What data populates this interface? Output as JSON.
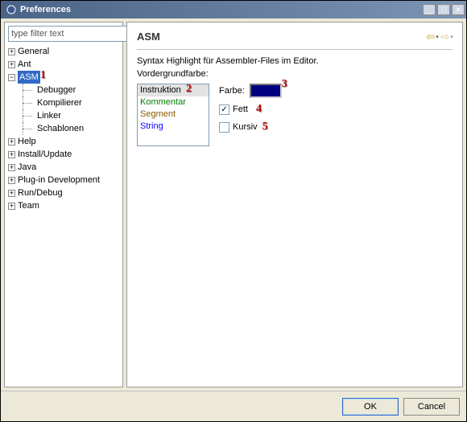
{
  "window": {
    "title": "Preferences"
  },
  "filter": {
    "placeholder": "type filter text"
  },
  "tree": {
    "general": "General",
    "ant": "Ant",
    "asm": "ASM",
    "asm_children": {
      "debugger": "Debugger",
      "kompilierer": "Kompilierer",
      "linker": "Linker",
      "schablonen": "Schablonen"
    },
    "help": "Help",
    "install": "Install/Update",
    "java": "Java",
    "plugin": "Plug-in Development",
    "run": "Run/Debug",
    "team": "Team"
  },
  "page": {
    "title": "ASM",
    "desc": "Syntax Highlight für Assembler-Files im Editor.",
    "fg_label": "Vordergrundfarbe:",
    "items": {
      "instruktion": "Instruktion",
      "kommentar": "Kommentar",
      "segment": "Segment",
      "string": "String"
    },
    "farbe_label": "Farbe:",
    "fett_label": "Fett",
    "kursiv_label": "Kursiv",
    "color_value": "#000080"
  },
  "buttons": {
    "ok": "OK",
    "cancel": "Cancel"
  },
  "hints": {
    "h1": "1",
    "h2": "2",
    "h3": "3",
    "h4": "4",
    "h5": "5"
  }
}
